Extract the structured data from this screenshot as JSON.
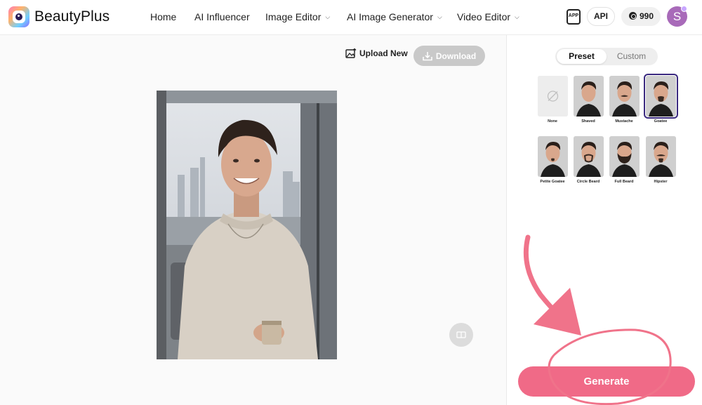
{
  "app": {
    "brand": "BeautyPlus"
  },
  "nav": {
    "home": "Home",
    "ai_influencer": "AI Influencer",
    "image_editor": "Image Editor",
    "ai_image_generator": "AI Image Generator",
    "video_editor": "Video Editor"
  },
  "header": {
    "app_icon_text": "APP",
    "api_label": "API",
    "credits": "990",
    "avatar_initial": "S"
  },
  "toolbar": {
    "upload_label": "Upload New",
    "download_label": "Download"
  },
  "panel": {
    "tabs": {
      "preset": "Preset",
      "custom": "Custom",
      "active": "preset"
    },
    "styles": [
      {
        "label": "None",
        "selected": false
      },
      {
        "label": "Shaved",
        "selected": false
      },
      {
        "label": "Mustache",
        "selected": false
      },
      {
        "label": "Goatee",
        "selected": true
      },
      {
        "label": "Petite Goatee",
        "selected": false
      },
      {
        "label": "Circle Beard",
        "selected": false
      },
      {
        "label": "Full Beard",
        "selected": false
      },
      {
        "label": "Hipster",
        "selected": false
      }
    ],
    "generate_label": "Generate"
  },
  "colors": {
    "accent": "#f06a87",
    "selected_outline": "#3b2a80",
    "annotation": "#f0738a"
  },
  "icons": {
    "upload": "image-upload-icon",
    "download": "download-icon",
    "compare": "compare-icon",
    "none": "no-style-icon",
    "coin": "coin-icon",
    "app": "app-icon"
  }
}
